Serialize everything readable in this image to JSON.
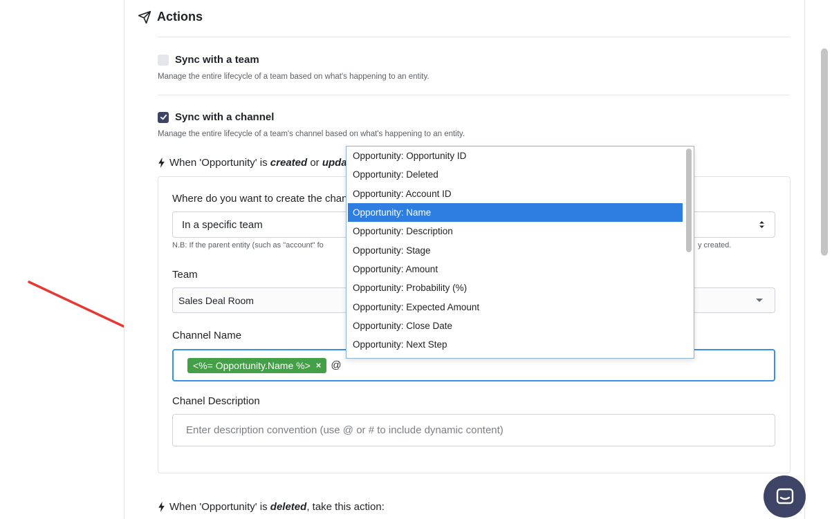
{
  "section": {
    "title": "Actions"
  },
  "sync_team": {
    "label": "Sync with a team",
    "checked": false,
    "helper": "Manage the entire lifecycle of a team based on what's happening to an entity."
  },
  "sync_channel": {
    "label": "Sync with a channel",
    "checked": true,
    "helper": "Manage the entire lifecycle of a team's channel based on what's happening to an entity."
  },
  "trigger_created": {
    "prefix": "When 'Opportunity' is ",
    "verb1": "created",
    "mid": " or ",
    "verb2": "upda"
  },
  "form": {
    "location_label": "Where do you want to create the chan",
    "location_value": "In a specific team",
    "note": "N.B: If the parent entity (such as \"account\" fo",
    "note_tail": "y created.",
    "team_label": "Team",
    "team_value": "Sales Deal Room",
    "channel_name_label": "Channel Name",
    "channel_tag": "<%= Opportunity.Name %>",
    "channel_tag_remove": "×",
    "channel_typed": "@",
    "description_label": "Chanel Description",
    "description_placeholder": "Enter description convention (use @ or # to include dynamic content)"
  },
  "dropdown": {
    "items": [
      "Opportunity: Opportunity ID",
      "Opportunity: Deleted",
      "Opportunity: Account ID",
      "Opportunity: Name",
      "Opportunity: Description",
      "Opportunity: Stage",
      "Opportunity: Amount",
      "Opportunity: Probability (%)",
      "Opportunity: Expected Amount",
      "Opportunity: Close Date",
      "Opportunity: Next Step"
    ],
    "active_index": 3
  },
  "trigger_deleted": {
    "prefix": "When 'Opportunity' is ",
    "verb": "deleted",
    "suffix": ", take this action:"
  },
  "colors": {
    "accent": "#2e7de1",
    "tag": "#43a047",
    "checkbox_on": "#3d4466",
    "arrow": "#e53935",
    "chat_button": "#3d4466"
  }
}
